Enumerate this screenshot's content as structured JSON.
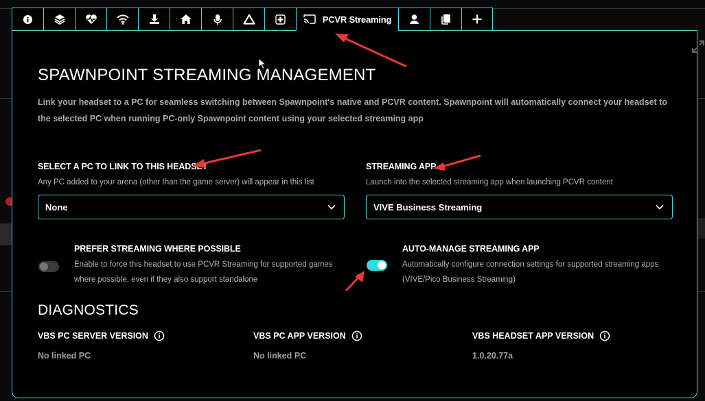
{
  "tabs": [
    {
      "icon": "info-icon",
      "label": ""
    },
    {
      "icon": "layers-icon",
      "label": ""
    },
    {
      "icon": "heartbeat-icon",
      "label": ""
    },
    {
      "icon": "wifi-icon",
      "label": ""
    },
    {
      "icon": "download-icon",
      "label": ""
    },
    {
      "icon": "home-icon",
      "label": ""
    },
    {
      "icon": "microphone-icon",
      "label": ""
    },
    {
      "icon": "triangle-logo-icon",
      "label": ""
    },
    {
      "icon": "dpad-icon",
      "label": ""
    },
    {
      "icon": "cast-icon",
      "label": "PCVR Streaming"
    },
    {
      "icon": "user-icon",
      "label": ""
    },
    {
      "icon": "copy-icon",
      "label": ""
    },
    {
      "icon": "plus-icon",
      "label": ""
    }
  ],
  "header": {
    "title": "SPAWNPOINT STREAMING MANAGEMENT",
    "description": "Link your headset to a PC for seamless switching between Spawnpoint's native and PCVR content. Spawnpoint will automatically connect your headset to the selected PC when running PC-only Spawnpoint content using your selected streaming app"
  },
  "pc_link": {
    "label": "SELECT A PC TO LINK TO THIS HEADSET",
    "hint": "Any PC added to your arena (other than the game server) will appear in this list",
    "value": "None"
  },
  "streaming_app": {
    "label": "STREAMING APP",
    "hint": "Launch into the selected streaming app when launching PCVR content",
    "value": "VIVE Business Streaming"
  },
  "prefer_streaming": {
    "label": "PREFER STREAMING WHERE POSSIBLE",
    "hint_line1": "Enable to force this headset to use PCVR Streaming for supported games",
    "hint_line2": "where possible, even if they also support standalone",
    "enabled": false
  },
  "auto_manage": {
    "label": "AUTO-MANAGE STREAMING APP",
    "hint_line1": "Automatically configure connection settings for supported streaming apps",
    "hint_line2": "(VIVE/Pico Business Streaming)",
    "enabled": true
  },
  "diagnostics": {
    "title": "DIAGNOSTICS",
    "items": [
      {
        "label": "VBS PC SERVER VERSION",
        "value": "No linked PC"
      },
      {
        "label": "VBS PC APP VERSION",
        "value": "No linked PC"
      },
      {
        "label": "VBS HEADSET APP VERSION",
        "value": "1.0.20.77a"
      }
    ]
  },
  "colors": {
    "accent": "#4fd4dc",
    "toggle_on": "#2fd9e0",
    "annotation_arrow": "#e53935"
  }
}
